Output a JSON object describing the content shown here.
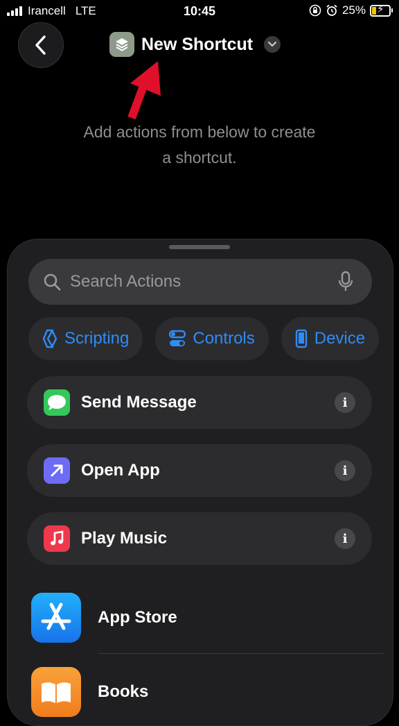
{
  "status": {
    "carrier": "Irancell",
    "network": "LTE",
    "time": "10:45",
    "battery": "25%",
    "battery_level": 0.25
  },
  "header": {
    "title": "New Shortcut",
    "icon": "layers-icon"
  },
  "hint": {
    "line1": "Add actions from below to create",
    "line2": "a shortcut."
  },
  "search": {
    "placeholder": "Search Actions"
  },
  "chips": [
    {
      "label": "Scripting",
      "icon": "scripting-icon"
    },
    {
      "label": "Controls",
      "icon": "controls-icon"
    },
    {
      "label": "Device",
      "icon": "device-icon"
    }
  ],
  "actions": [
    {
      "label": "Send Message",
      "icon": "messages-icon",
      "info": "i"
    },
    {
      "label": "Open App",
      "icon": "open-app-icon",
      "info": "i"
    },
    {
      "label": "Play Music",
      "icon": "music-icon",
      "info": "i"
    }
  ],
  "apps": [
    {
      "label": "App Store",
      "icon": "app-store-icon"
    },
    {
      "label": "Books",
      "icon": "books-icon"
    }
  ],
  "colors": {
    "accent": "#2f8cf7",
    "arrow": "#e0102a",
    "messages": "#34c759",
    "open_app": "#6e6cf5",
    "music": "#f0384c",
    "app_store": "#1d8ff5",
    "books": "#f7932a"
  }
}
